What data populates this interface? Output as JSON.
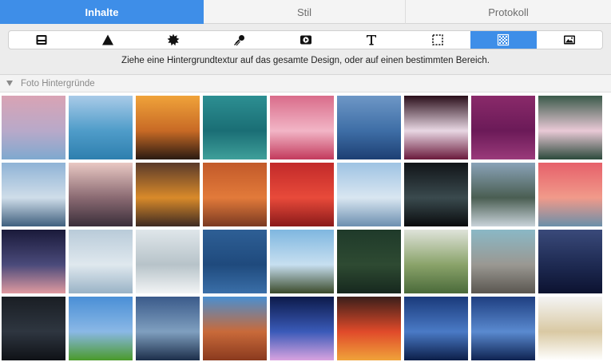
{
  "tabs": [
    {
      "label": "Inhalte",
      "active": true
    },
    {
      "label": "Stil",
      "active": false
    },
    {
      "label": "Protokoll",
      "active": false
    }
  ],
  "toolbar": {
    "tools": [
      {
        "icon": "layout-block-icon",
        "active": false
      },
      {
        "icon": "triangle-shape-icon",
        "active": false
      },
      {
        "icon": "starburst-icon",
        "active": false
      },
      {
        "icon": "comet-icon",
        "active": false
      },
      {
        "icon": "video-play-icon",
        "active": false
      },
      {
        "icon": "text-tool-icon",
        "active": false
      },
      {
        "icon": "dashed-selection-icon",
        "active": false
      },
      {
        "icon": "texture-pattern-icon",
        "active": true
      },
      {
        "icon": "photo-icon",
        "active": false
      }
    ]
  },
  "hint_text": "Ziehe eine Hintergrundtextur auf das gesamte Design, oder auf einen bestimmten Bereich.",
  "section": {
    "title": "Foto Hintergründe",
    "expanded": true
  },
  "colors": {
    "accent": "#3e8ee8",
    "tab_inactive_text": "#6d6d6d",
    "section_text": "#8a8a8a"
  },
  "thumbnails": [
    {
      "name": "sunset-sea-pastel",
      "colors": [
        "#d9a3b4",
        "#b8a9c9",
        "#7fa9cf"
      ]
    },
    {
      "name": "ocean-horizon-blue",
      "colors": [
        "#a9cbe8",
        "#4f9cc9",
        "#2e7fae"
      ]
    },
    {
      "name": "orange-sunset-silhouette",
      "colors": [
        "#f0a33a",
        "#c86a25",
        "#2a1a12"
      ]
    },
    {
      "name": "turquoise-water-aerial",
      "colors": [
        "#2d8f92",
        "#1a6e75",
        "#3f9f9a"
      ]
    },
    {
      "name": "cupcakes-sprinkles",
      "colors": [
        "#d96c8a",
        "#f2b5c6",
        "#c33a5c"
      ]
    },
    {
      "name": "blue-mountain-layers",
      "colors": [
        "#6e97c6",
        "#3e6ea6",
        "#1d3f73"
      ]
    },
    {
      "name": "white-dahlia-flower",
      "colors": [
        "#2a0e1a",
        "#e8d7e3",
        "#6a1a3c"
      ]
    },
    {
      "name": "purple-lavender-field",
      "colors": [
        "#8a2a6a",
        "#6b1a58",
        "#9a3a7a"
      ]
    },
    {
      "name": "pink-water-lily",
      "colors": [
        "#3a5a4a",
        "#e9c9d6",
        "#2c4a3c"
      ]
    },
    {
      "name": "snowy-mountain-clouds",
      "colors": [
        "#8fb3d6",
        "#cfdde9",
        "#3f5f7e"
      ]
    },
    {
      "name": "city-skyline-dusk",
      "colors": [
        "#e9c8c3",
        "#8a6a72",
        "#3a2e3a"
      ]
    },
    {
      "name": "pumpkins-wood",
      "colors": [
        "#5a3a2a",
        "#d98a2a",
        "#3e2a22"
      ]
    },
    {
      "name": "orange-pumpkins-pile",
      "colors": [
        "#c25a2a",
        "#e27a3a",
        "#7a3a22"
      ]
    },
    {
      "name": "red-apples",
      "colors": [
        "#c22a2a",
        "#e84a3a",
        "#8a1a1a"
      ]
    },
    {
      "name": "golden-gate-fog",
      "colors": [
        "#9ec3e3",
        "#d9e6f1",
        "#6c8fb0"
      ]
    },
    {
      "name": "concert-lights-dark",
      "colors": [
        "#111418",
        "#3a4a4e",
        "#0a0c0e"
      ]
    },
    {
      "name": "misty-mountain-forest",
      "colors": [
        "#8aa3b8",
        "#4a5e52",
        "#c9d3da"
      ]
    },
    {
      "name": "pink-sunset-sea",
      "colors": [
        "#e6606a",
        "#f19a8a",
        "#6a8fa9"
      ]
    },
    {
      "name": "purple-dusk-horizon",
      "colors": [
        "#1a1a3a",
        "#4a4a7a",
        "#e09aa0"
      ]
    },
    {
      "name": "pale-sky-clouds",
      "colors": [
        "#b9cbd9",
        "#dfe8ee",
        "#9ab3c6"
      ]
    },
    {
      "name": "frosted-forest",
      "colors": [
        "#dfe6ea",
        "#b7c3c9",
        "#f2f4f5"
      ]
    },
    {
      "name": "deep-blue-sea",
      "colors": [
        "#2e5f95",
        "#1f4a7d",
        "#3a6fa8"
      ]
    },
    {
      "name": "palm-trees-sky",
      "colors": [
        "#7fb7e0",
        "#c7dff0",
        "#3a4a2a"
      ]
    },
    {
      "name": "pine-forest-aerial",
      "colors": [
        "#1f3a2a",
        "#2e4a32",
        "#16281e"
      ]
    },
    {
      "name": "dandelion-meadow",
      "colors": [
        "#dfe3da",
        "#8aa36a",
        "#4a6a3a"
      ]
    },
    {
      "name": "pebble-beach",
      "colors": [
        "#8ab8c6",
        "#9a9892",
        "#5a5650"
      ]
    },
    {
      "name": "night-mountain-silhouette",
      "colors": [
        "#3a4a7a",
        "#1e2a52",
        "#0c1230"
      ]
    },
    {
      "name": "star-trails-night",
      "colors": [
        "#1a1e24",
        "#2e3640",
        "#0f1216"
      ]
    },
    {
      "name": "green-hill-blue-sky",
      "colors": [
        "#4a8fd6",
        "#8ab8e6",
        "#4a9a2a"
      ]
    },
    {
      "name": "calm-sea-twilight",
      "colors": [
        "#3a5a8a",
        "#7f9fbf",
        "#1c2e4a"
      ]
    },
    {
      "name": "canyon-hoodoos",
      "colors": [
        "#4a8fd0",
        "#c96a3a",
        "#8a3a1e"
      ]
    },
    {
      "name": "fireworks-night",
      "colors": [
        "#0c1a4a",
        "#3a5ab8",
        "#d9a3e0"
      ]
    },
    {
      "name": "red-phone-booth-lights",
      "colors": [
        "#3a1e1a",
        "#e04a2a",
        "#f0a33a"
      ]
    },
    {
      "name": "milky-way-blue",
      "colors": [
        "#1a3a7a",
        "#4a7ac6",
        "#0c1e48"
      ]
    },
    {
      "name": "galaxy-sky-blue",
      "colors": [
        "#1e3e80",
        "#5a8ad0",
        "#0e2250"
      ]
    },
    {
      "name": "white-daisy-closeup",
      "colors": [
        "#f4f4f4",
        "#d9c9a3",
        "#ffffff"
      ]
    }
  ]
}
